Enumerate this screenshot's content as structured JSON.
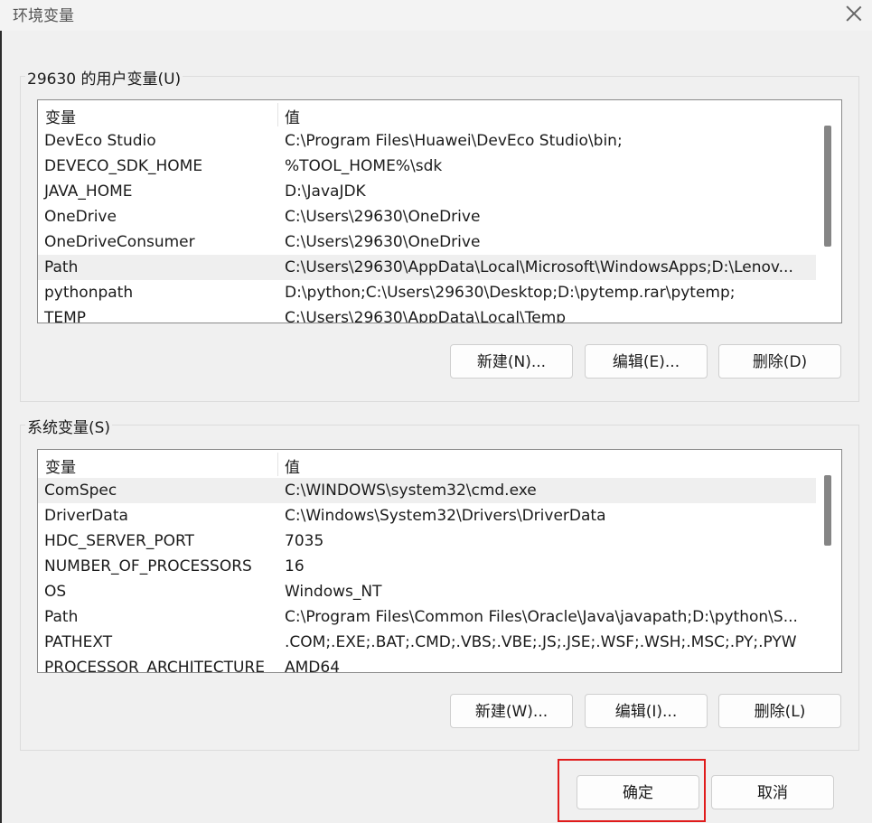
{
  "window": {
    "title": "环境变量"
  },
  "user_vars": {
    "label": "29630 的用户变量(U)",
    "headers": [
      "变量",
      "值"
    ],
    "rows": [
      {
        "name": "DevEco Studio",
        "value": "C:\\Program Files\\Huawei\\DevEco Studio\\bin;"
      },
      {
        "name": "DEVECO_SDK_HOME",
        "value": "%TOOL_HOME%\\sdk"
      },
      {
        "name": "JAVA_HOME",
        "value": "D:\\JavaJDK"
      },
      {
        "name": "OneDrive",
        "value": "C:\\Users\\29630\\OneDrive"
      },
      {
        "name": "OneDriveConsumer",
        "value": "C:\\Users\\29630\\OneDrive"
      },
      {
        "name": "Path",
        "value": "C:\\Users\\29630\\AppData\\Local\\Microsoft\\WindowsApps;D:\\Lenov..."
      },
      {
        "name": "pythonpath",
        "value": "D:\\python;C:\\Users\\29630\\Desktop;D:\\pytemp.rar\\pytemp;"
      },
      {
        "name": "TEMP",
        "value": "C:\\Users\\29630\\AppData\\Local\\Temp"
      }
    ],
    "buttons": {
      "new": "新建(N)...",
      "edit": "编辑(E)...",
      "delete": "删除(D)"
    }
  },
  "system_vars": {
    "label": "系统变量(S)",
    "headers": [
      "变量",
      "值"
    ],
    "rows": [
      {
        "name": "ComSpec",
        "value": "C:\\WINDOWS\\system32\\cmd.exe"
      },
      {
        "name": "DriverData",
        "value": "C:\\Windows\\System32\\Drivers\\DriverData"
      },
      {
        "name": "HDC_SERVER_PORT",
        "value": "7035"
      },
      {
        "name": "NUMBER_OF_PROCESSORS",
        "value": "16"
      },
      {
        "name": "OS",
        "value": "Windows_NT"
      },
      {
        "name": "Path",
        "value": "C:\\Program Files\\Common Files\\Oracle\\Java\\javapath;D:\\python\\S..."
      },
      {
        "name": "PATHEXT",
        "value": ".COM;.EXE;.BAT;.CMD;.VBS;.VBE;.JS;.JSE;.WSF;.WSH;.MSC;.PY;.PYW"
      },
      {
        "name": "PROCESSOR_ARCHITECTURE",
        "value": "AMD64"
      }
    ],
    "buttons": {
      "new": "新建(W)...",
      "edit": "编辑(I)...",
      "delete": "删除(L)"
    }
  },
  "footer": {
    "ok": "确定",
    "cancel": "取消"
  },
  "colors": {
    "highlight": "#e01b1b",
    "selected_row": "#efefef"
  }
}
